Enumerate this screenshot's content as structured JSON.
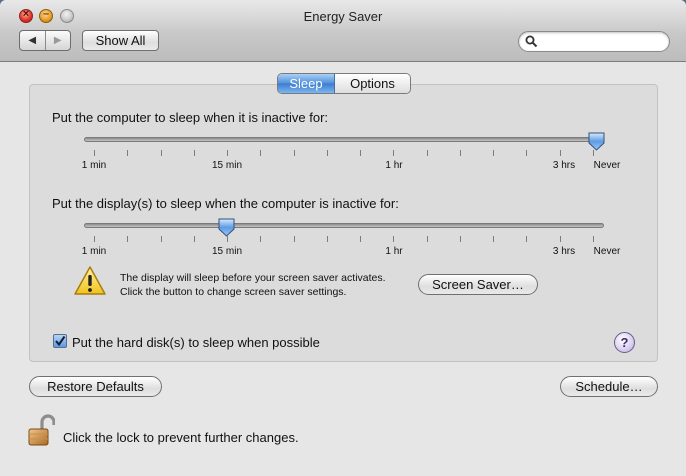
{
  "window": {
    "title": "Energy Saver"
  },
  "toolbar": {
    "back_glyph": "◀",
    "forward_glyph": "▶",
    "show_all_label": "Show All",
    "search_placeholder": ""
  },
  "tabs": [
    {
      "label": "Sleep",
      "selected": true
    },
    {
      "label": "Options",
      "selected": false
    }
  ],
  "computer_sleep": {
    "label": "Put the computer to sleep when it is inactive for:",
    "value": "Never",
    "tick_labels": [
      "1 min",
      "15 min",
      "1 hr",
      "3 hrs",
      "Never"
    ]
  },
  "display_sleep": {
    "label": "Put the display(s) to sleep when the computer is inactive for:",
    "value": "15 min",
    "tick_labels": [
      "1 min",
      "15 min",
      "1 hr",
      "3 hrs",
      "Never"
    ]
  },
  "warning": {
    "line1": "The display will sleep before your screen saver activates.",
    "line2": "Click the button to change screen saver settings."
  },
  "buttons": {
    "screen_saver": "Screen Saver…",
    "restore_defaults": "Restore Defaults",
    "schedule": "Schedule…"
  },
  "hard_disk": {
    "label": "Put the hard disk(s) to sleep when possible",
    "checked": true
  },
  "help": {
    "glyph": "?"
  },
  "lock": {
    "text": "Click the lock to prevent further changes.",
    "icon": "lock-icon"
  },
  "colors": {
    "selected_tab": "#4f8fda",
    "window_bg": "#e6e6e6",
    "desktop": "#5a6f86"
  }
}
